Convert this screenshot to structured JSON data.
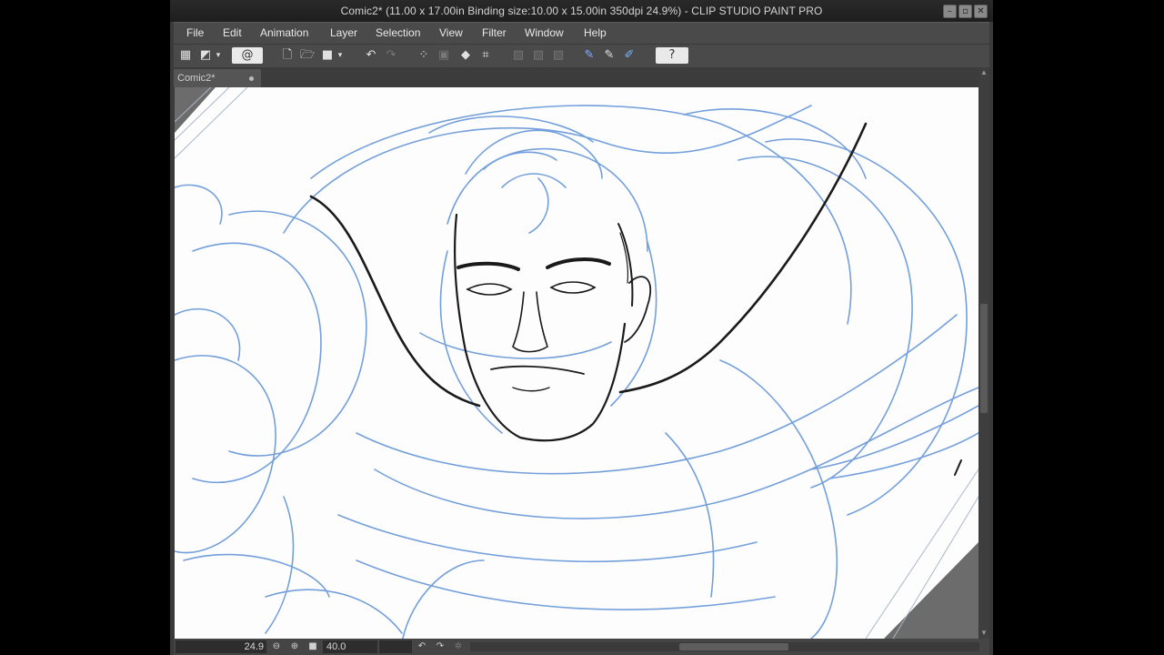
{
  "window": {
    "title": "Comic2* (11.00 x 17.00in Binding size:10.00 x 15.00in 350dpi 24.9%)  - CLIP STUDIO PAINT PRO",
    "controls": [
      "minimize-icon",
      "restore-icon",
      "close-icon"
    ]
  },
  "menu": {
    "items": [
      "File",
      "Edit",
      "Animation",
      "Layer",
      "Selection",
      "View",
      "Filter",
      "Window",
      "Help"
    ]
  },
  "toolbar": {
    "icons": [
      "grid-icon",
      "canvas-icon",
      "dropdown-icon",
      "swirl-icon",
      "new-icon",
      "open-icon",
      "save-icon",
      "dropdown-icon",
      "undo-icon",
      "redo-icon",
      "transform-icon",
      "clear-icon",
      "fill-icon",
      "crop-icon",
      "disabled-icon",
      "disabled-icon",
      "disabled-icon",
      "pen-icon",
      "pen-icon",
      "pen-icon",
      "help-icon"
    ]
  },
  "tab": {
    "label": "Comic2*"
  },
  "status": {
    "zoom": "24.9",
    "angle": "40.0"
  },
  "colors": {
    "sketch_blue": "#5b8fd6",
    "ink": "#111111",
    "ui_dark": "#3a3a3a"
  }
}
